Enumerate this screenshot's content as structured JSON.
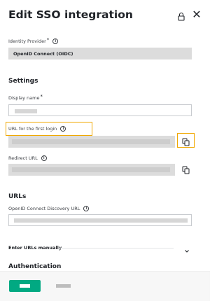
{
  "header": {
    "title": "Edit SSO integration",
    "lock_icon": "lock-icon",
    "close_icon": "close-icon",
    "close_glyph": "✕"
  },
  "identity_provider": {
    "label": "Identity Provider",
    "required_mark": "*",
    "value": "OpenID Connect (OIDC)"
  },
  "settings": {
    "heading": "Settings",
    "display_name": {
      "label": "Display name",
      "required_mark": "*"
    },
    "first_login_url": {
      "label": "URL for the first login"
    },
    "redirect_url": {
      "label": "Redirect URL"
    }
  },
  "urls": {
    "heading": "URLs",
    "discovery_url": {
      "label": "OpenID Connect Discovery URL"
    },
    "manual_toggle": {
      "label": "Enter URLs manually",
      "icon": "chevron-down-icon"
    }
  },
  "authentication": {
    "heading": "Authentication"
  },
  "info_glyph": "i",
  "colors": {
    "primary": "#01a982",
    "highlight": "#f0a800",
    "readonly_field": "#dcdcdc"
  }
}
